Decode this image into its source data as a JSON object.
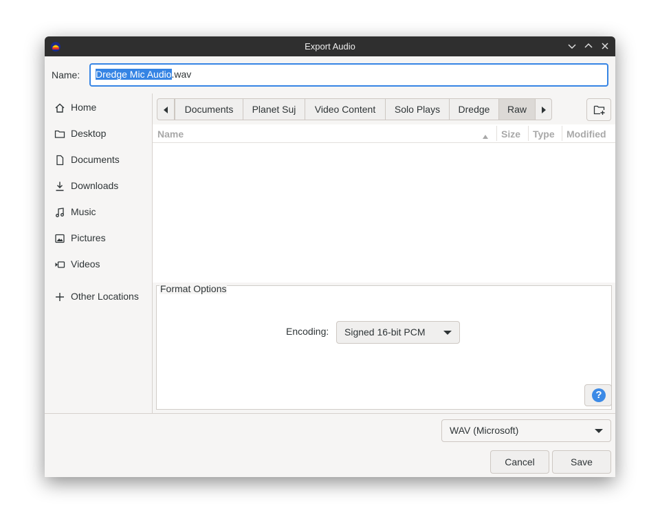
{
  "window": {
    "title": "Export Audio"
  },
  "name_row": {
    "label": "Name:",
    "filename_selected": "Dredge Mic Audio",
    "filename_ext": ".wav"
  },
  "sidebar": {
    "items": [
      {
        "label": "Home",
        "icon": "home-icon"
      },
      {
        "label": "Desktop",
        "icon": "folder-icon"
      },
      {
        "label": "Documents",
        "icon": "document-icon"
      },
      {
        "label": "Downloads",
        "icon": "download-icon"
      },
      {
        "label": "Music",
        "icon": "music-icon"
      },
      {
        "label": "Pictures",
        "icon": "picture-icon"
      },
      {
        "label": "Videos",
        "icon": "video-icon"
      }
    ],
    "other_locations": "Other Locations"
  },
  "path_bar": {
    "segments": [
      "Documents",
      "Planet Suj",
      "Video Content",
      "Solo Plays",
      "Dredge",
      "Raw"
    ],
    "active": "Raw"
  },
  "file_list": {
    "columns": {
      "name": "Name",
      "size": "Size",
      "type": "Type",
      "modified": "Modified"
    }
  },
  "format_options": {
    "title": "Format Options",
    "encoding_label": "Encoding:",
    "encoding_value": "Signed 16-bit PCM"
  },
  "bottom": {
    "format_value": "WAV (Microsoft)",
    "cancel_label": "Cancel",
    "save_label": "Save"
  },
  "colors": {
    "accent": "#3584e4",
    "titlebar": "#2f2f2f"
  }
}
